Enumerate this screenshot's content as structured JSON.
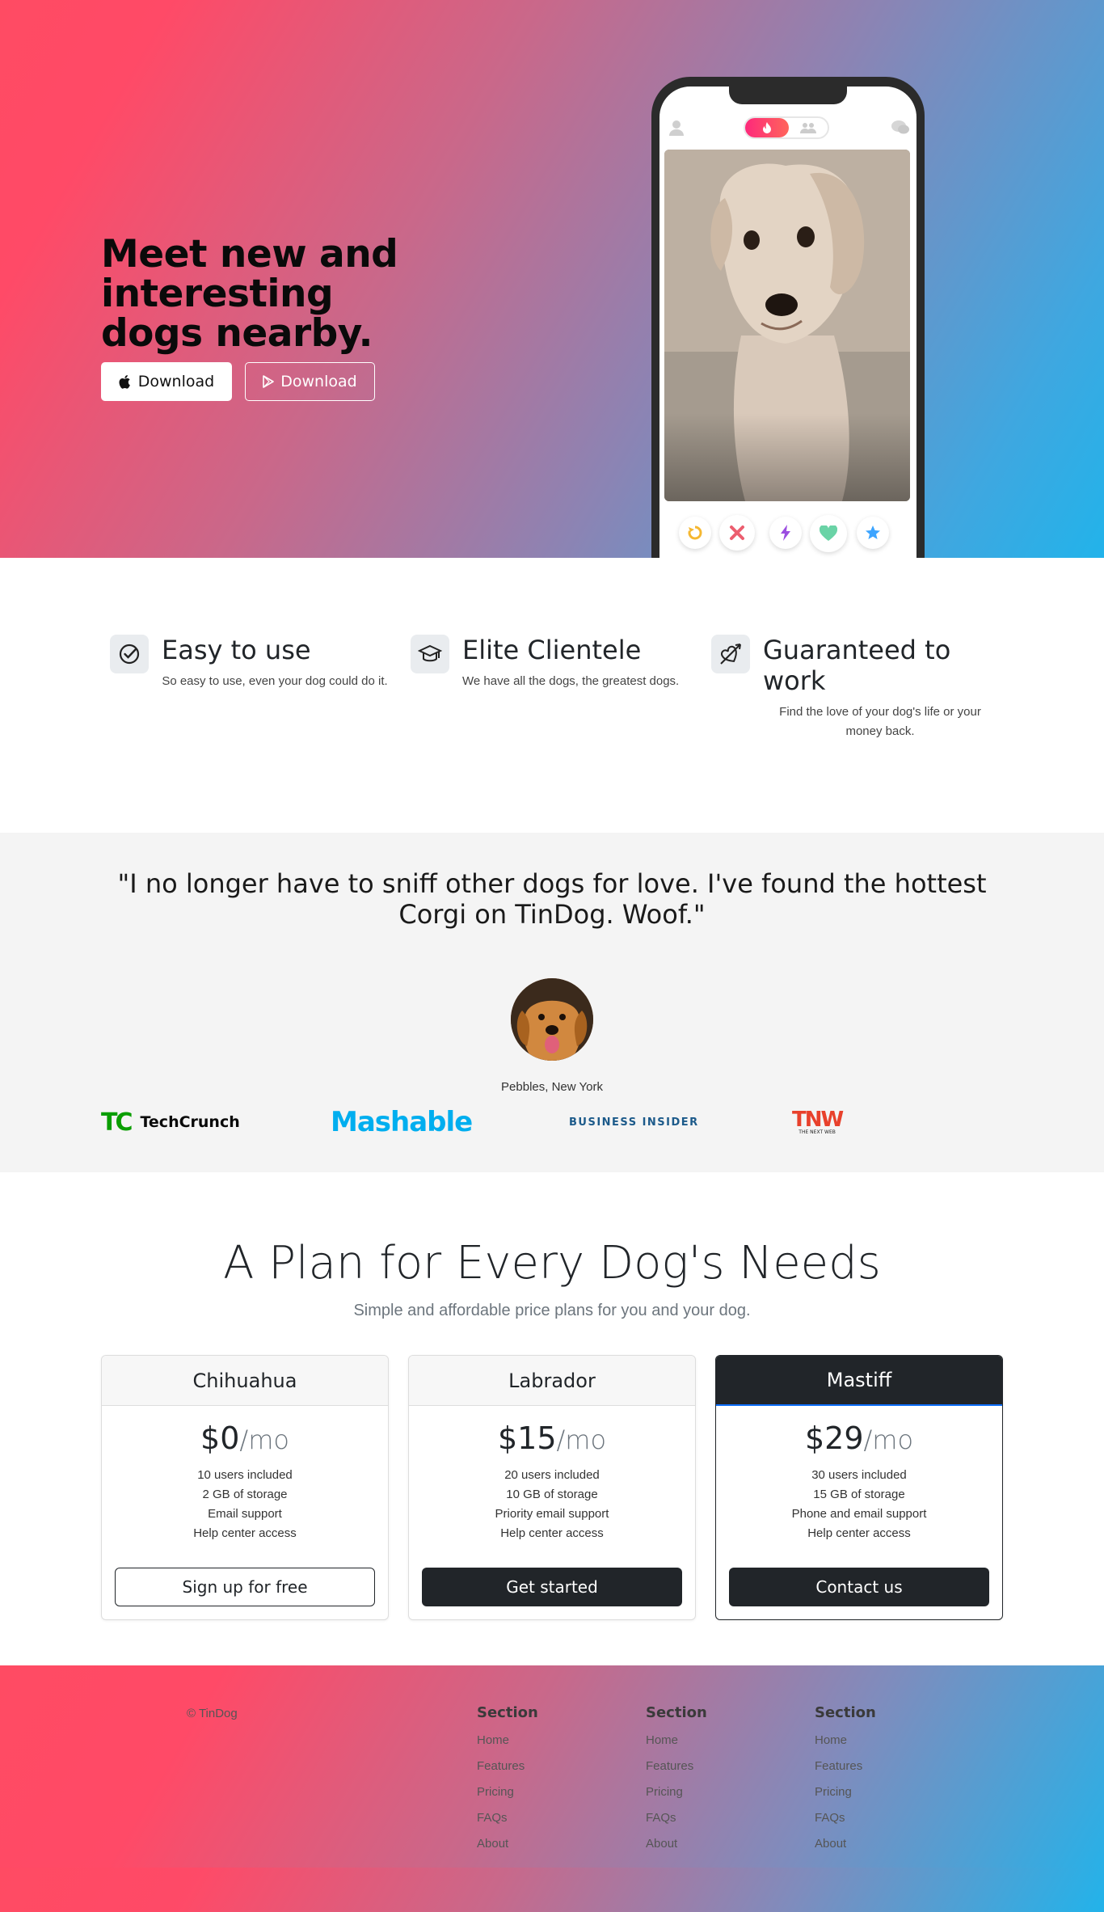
{
  "hero": {
    "title": "Meet new and interesting dogs nearby.",
    "apple_btn": "Download",
    "play_btn": "Download"
  },
  "features": [
    {
      "title": "Easy to use",
      "text": "So easy to use, even your dog could do it.",
      "icon": "check-circle-icon"
    },
    {
      "title": "Elite Clientele",
      "text": "We have all the dogs, the greatest dogs.",
      "icon": "graduation-cap-icon"
    },
    {
      "title": "Guaranteed to work",
      "text": "Find the love of your dog's life or your money back.",
      "icon": "arrow-heart-icon"
    }
  ],
  "testimonial": {
    "quote": "\"I no longer have to sniff other dogs for love. I've found the hottest Corgi on TinDog. Woof.\"",
    "author": "Pebbles, New York"
  },
  "press": {
    "techcrunch_mark": "TC",
    "techcrunch": "TechCrunch",
    "mashable": "Mashable",
    "business_insider": "BUSINESS INSIDER",
    "tnw": "TNW",
    "tnw_sub": "THE NEXT WEB"
  },
  "pricing": {
    "title": "A Plan for Every Dog's Needs",
    "subtitle": "Simple and affordable price plans for you and your dog.",
    "per": "/mo",
    "plans": [
      {
        "name": "Chihuahua",
        "price": "$0",
        "f1": "10 users included",
        "f2": "2 GB of storage",
        "f3": "Email support",
        "f4": "Help center access",
        "cta": "Sign up for free"
      },
      {
        "name": "Labrador",
        "price": "$15",
        "f1": "20 users included",
        "f2": "10 GB of storage",
        "f3": "Priority email support",
        "f4": "Help center access",
        "cta": "Get started"
      },
      {
        "name": "Mastiff",
        "price": "$29",
        "f1": "30 users included",
        "f2": "15 GB of storage",
        "f3": "Phone and email support",
        "f4": "Help center access",
        "cta": "Contact us"
      }
    ]
  },
  "footer": {
    "copyright": "© TinDog",
    "columns": [
      {
        "heading": "Section",
        "links": [
          "Home",
          "Features",
          "Pricing",
          "FAQs",
          "About"
        ]
      },
      {
        "heading": "Section",
        "links": [
          "Home",
          "Features",
          "Pricing",
          "FAQs",
          "About"
        ]
      },
      {
        "heading": "Section",
        "links": [
          "Home",
          "Features",
          "Pricing",
          "FAQs",
          "About"
        ]
      }
    ]
  },
  "colors": {
    "brand_red": "#ff4b63",
    "brand_blue": "#22b3ea",
    "dark": "#212529",
    "techcrunch_green": "#0a9e01",
    "mashable_blue": "#00aeef",
    "bi_blue": "#1c5a8a",
    "tnw_red": "#e8412c"
  }
}
